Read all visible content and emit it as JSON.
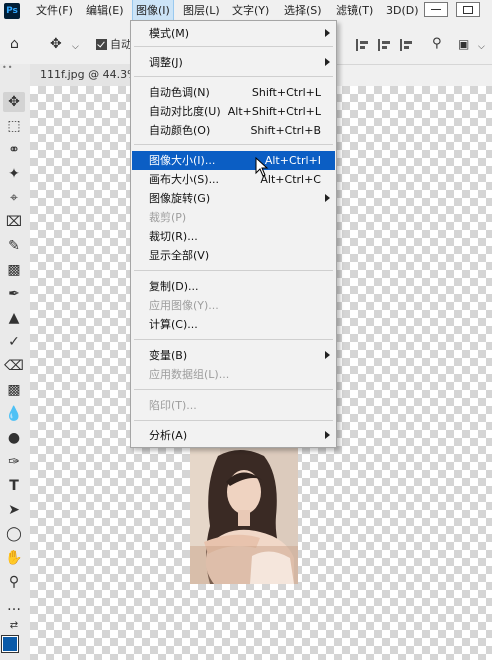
{
  "app": {
    "logo_text": "Ps",
    "accent": "#31a8ff"
  },
  "menubar": {
    "items": [
      "文件(F)",
      "编辑(E)",
      "图像(I)",
      "图层(L)",
      "文字(Y)",
      "选择(S)",
      "滤镜(T)",
      "3D(D)"
    ],
    "active": "图像(I)"
  },
  "options_bar": {
    "auto_select_label": "自动"
  },
  "document": {
    "tab_title": "111f.jpg @ 44.3%"
  },
  "image_menu": {
    "items": [
      {
        "label": "模式(M)",
        "shortcut": "",
        "submenu": true,
        "enabled": true
      },
      {
        "label": "调整(J)",
        "shortcut": "",
        "submenu": true,
        "enabled": true
      },
      {
        "label": "自动色调(N)",
        "shortcut": "Shift+Ctrl+L",
        "submenu": false,
        "enabled": true
      },
      {
        "label": "自动对比度(U)",
        "shortcut": "Alt+Shift+Ctrl+L",
        "submenu": false,
        "enabled": true
      },
      {
        "label": "自动颜色(O)",
        "shortcut": "Shift+Ctrl+B",
        "submenu": false,
        "enabled": true
      },
      {
        "label": "图像大小(I)...",
        "shortcut": "Alt+Ctrl+I",
        "submenu": false,
        "enabled": true,
        "highlighted": true
      },
      {
        "label": "画布大小(S)...",
        "shortcut": "Alt+Ctrl+C",
        "submenu": false,
        "enabled": true
      },
      {
        "label": "图像旋转(G)",
        "shortcut": "",
        "submenu": true,
        "enabled": true
      },
      {
        "label": "裁剪(P)",
        "shortcut": "",
        "submenu": false,
        "enabled": false
      },
      {
        "label": "裁切(R)...",
        "shortcut": "",
        "submenu": false,
        "enabled": true
      },
      {
        "label": "显示全部(V)",
        "shortcut": "",
        "submenu": false,
        "enabled": true
      },
      {
        "label": "复制(D)...",
        "shortcut": "",
        "submenu": false,
        "enabled": true
      },
      {
        "label": "应用图像(Y)...",
        "shortcut": "",
        "submenu": false,
        "enabled": false
      },
      {
        "label": "计算(C)...",
        "shortcut": "",
        "submenu": false,
        "enabled": true
      },
      {
        "label": "变量(B)",
        "shortcut": "",
        "submenu": true,
        "enabled": true
      },
      {
        "label": "应用数据组(L)...",
        "shortcut": "",
        "submenu": false,
        "enabled": false
      },
      {
        "label": "陷印(T)...",
        "shortcut": "",
        "submenu": false,
        "enabled": false
      },
      {
        "label": "分析(A)",
        "shortcut": "",
        "submenu": true,
        "enabled": true
      }
    ]
  },
  "toolbar": {
    "foreground_color": "#0a5aa8"
  }
}
